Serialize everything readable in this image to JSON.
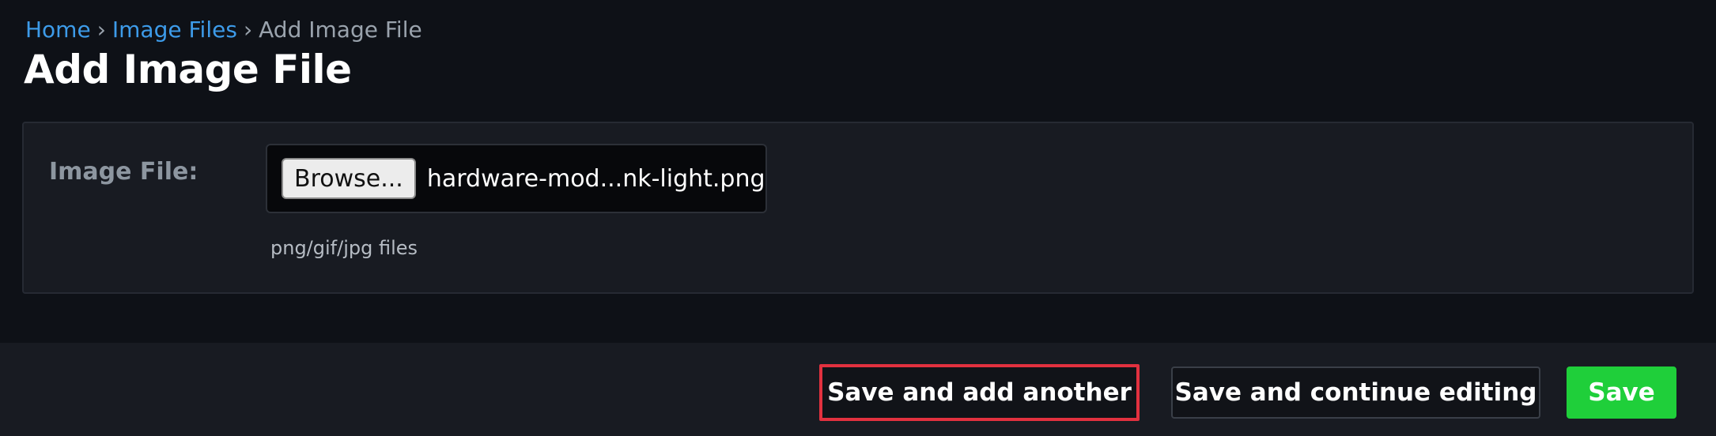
{
  "breadcrumb": {
    "home": "Home",
    "separator": "›",
    "image_files": "Image Files",
    "current": "Add Image File"
  },
  "page": {
    "title": "Add Image File"
  },
  "form": {
    "image_file": {
      "label": "Image File:",
      "browse_label": "Browse...",
      "file_name": "hardware-mod...nk-light.png",
      "help_text": "png/gif/jpg files"
    }
  },
  "actions": {
    "save_and_add_another": "Save and add another",
    "save_and_continue": "Save and continue editing",
    "save": "Save"
  },
  "colors": {
    "background": "#0e1117",
    "panel": "#181b22",
    "link": "#3d9be9",
    "save_green": "#1fcf3a",
    "highlight_red": "#e2313f"
  }
}
